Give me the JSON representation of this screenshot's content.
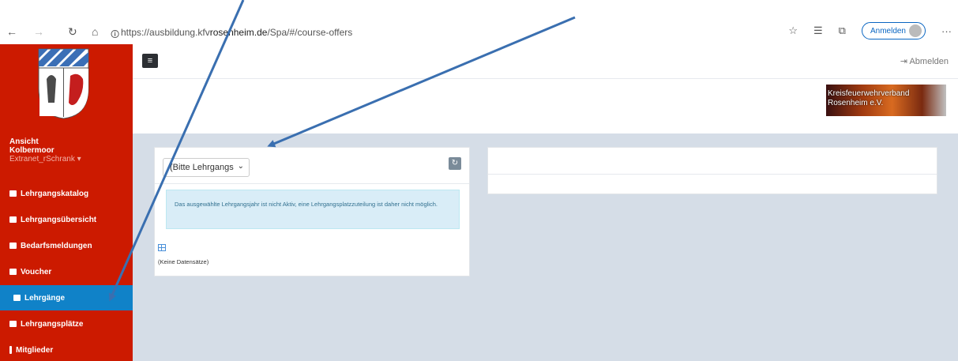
{
  "browser": {
    "url_prefix": "https://ausbildung.kfv",
    "url_host": "rosenheim.de",
    "url_suffix": "/Spa/#/course-offers",
    "signin_label": "Anmelden"
  },
  "sidebar": {
    "user_line1": "Ansicht",
    "user_line2": "Kolbermoor",
    "user_role": "Extranet_rSchrank",
    "items": [
      {
        "label": "Lehrgangskatalog"
      },
      {
        "label": "Lehrgangsübersicht"
      },
      {
        "label": "Bedarfsmeldungen"
      },
      {
        "label": "Voucher"
      },
      {
        "label": "Lehrgänge",
        "active": true
      },
      {
        "label": "Lehrgangsplätze"
      },
      {
        "label": "Mitglieder"
      }
    ]
  },
  "header": {
    "logout_label": "Abmelden",
    "logo_line1": "Kreisfeuerwehrverband",
    "logo_line2": "Rosenheim e.V."
  },
  "main": {
    "select_value": "(Bitte Lehrgangs",
    "alert_text": "Das ausgewählte Lehrgangsjahr ist nicht Aktiv, eine Lehrgangsplatzzuteilung ist daher nicht möglich.",
    "empty_text": "(Keine Datensätze)"
  },
  "colors": {
    "sidebar_bg": "#cc1a00",
    "active_item_bg": "#1082c8",
    "content_bg": "#d5dde7",
    "alert_bg": "#d9edf7",
    "arrow_color": "#3a6fb0"
  }
}
